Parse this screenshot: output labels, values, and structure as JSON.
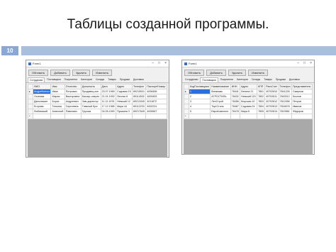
{
  "slide": {
    "title": "Таблицы созданной программы.",
    "number": "10"
  },
  "left_window": {
    "title": "Form1",
    "controls": [
      "–",
      "□",
      "×"
    ],
    "toolbar": [
      "Обновить",
      "Добавить",
      "Удалить",
      "Изменить"
    ],
    "tabs": [
      "Сотрудники",
      "Поставщики",
      "Покупатели",
      "Категории",
      "Склады",
      "Товары",
      "Продажи",
      "Доставка"
    ],
    "active_tab": 0,
    "columns": [
      "",
      "ФИО",
      "Имя",
      "Отчество",
      "Должность",
      "Дата",
      "Адрес",
      "Телефон",
      "Паспорт/Номер"
    ],
    "rows": [
      [
        "▸",
        "Андрейченко",
        "Иван",
        "Петрович",
        "Продавец-кон",
        "23.07.1989",
        "Садовая 15",
        "89215531",
        "4008456"
      ],
      [
        "",
        "Осипова",
        "Мария",
        "Викторовна",
        "Кассир-операт",
        "21.01.1992",
        "Лесная 8",
        "89114532",
        "4009453"
      ],
      [
        "",
        "Данилишин",
        "Борис",
        "Андреевич",
        "Зам директор",
        "11.12.1978",
        "Невский 12",
        "89213345",
        "4011872"
      ],
      [
        "",
        "Егорова",
        "Татьяна",
        "Сергеевна",
        "Главный бухг",
        "17.12.1985",
        "Мира 44",
        "89112233",
        "4002231"
      ],
      [
        "",
        "Любимский",
        "Анатолий",
        "Павлович",
        "Грузчик",
        "04.05.1990",
        "Пушкина 3",
        "89217645",
        "4005567"
      ],
      [
        "*",
        "",
        "",
        "",
        "",
        "",
        "",
        "",
        ""
      ]
    ]
  },
  "right_window": {
    "title": "Form1",
    "controls": [
      "–",
      "□",
      "×"
    ],
    "toolbar": [
      "Обновить",
      "Добавить",
      "Удалить",
      "Изменить"
    ],
    "tabs": [
      "Сотрудники",
      "Поставщики",
      "Покупатели",
      "Категории",
      "Склады",
      "Товары",
      "Продажи",
      "Доставка"
    ],
    "active_tab": 1,
    "columns": [
      "",
      "КодПоставщика",
      "Наименование",
      "ИНН",
      "Адрес",
      "КПП",
      "РасчСчет",
      "Телефон",
      "Представитель"
    ],
    "rows": [
      [
        "▸",
        "1",
        "Витамакс",
        "78441",
        "Ленина 21",
        "7801",
        "40702810",
        "7841226",
        "Смирнов"
      ],
      [
        "",
        "2",
        "АГРОСТИЛЬ",
        "78432",
        "Невский 115",
        "7802",
        "40702811",
        "7843312",
        "Козлов"
      ],
      [
        "",
        "3",
        "ЛенСтрой",
        "78456",
        "Морская 10",
        "7803",
        "40702812",
        "7812456",
        "Петров"
      ],
      [
        "",
        "4",
        "ТоргСтиль",
        "78467",
        "Садовая 24",
        "7804",
        "40702813",
        "7816678",
        "Иванов"
      ],
      [
        "",
        "5",
        "ЕвроКомплект",
        "78478",
        "Мира 6",
        "7805",
        "40702814",
        "7819981",
        "Фёдоров"
      ],
      [
        "*",
        "",
        "",
        "",
        "",
        "",
        "",
        "",
        ""
      ]
    ]
  }
}
